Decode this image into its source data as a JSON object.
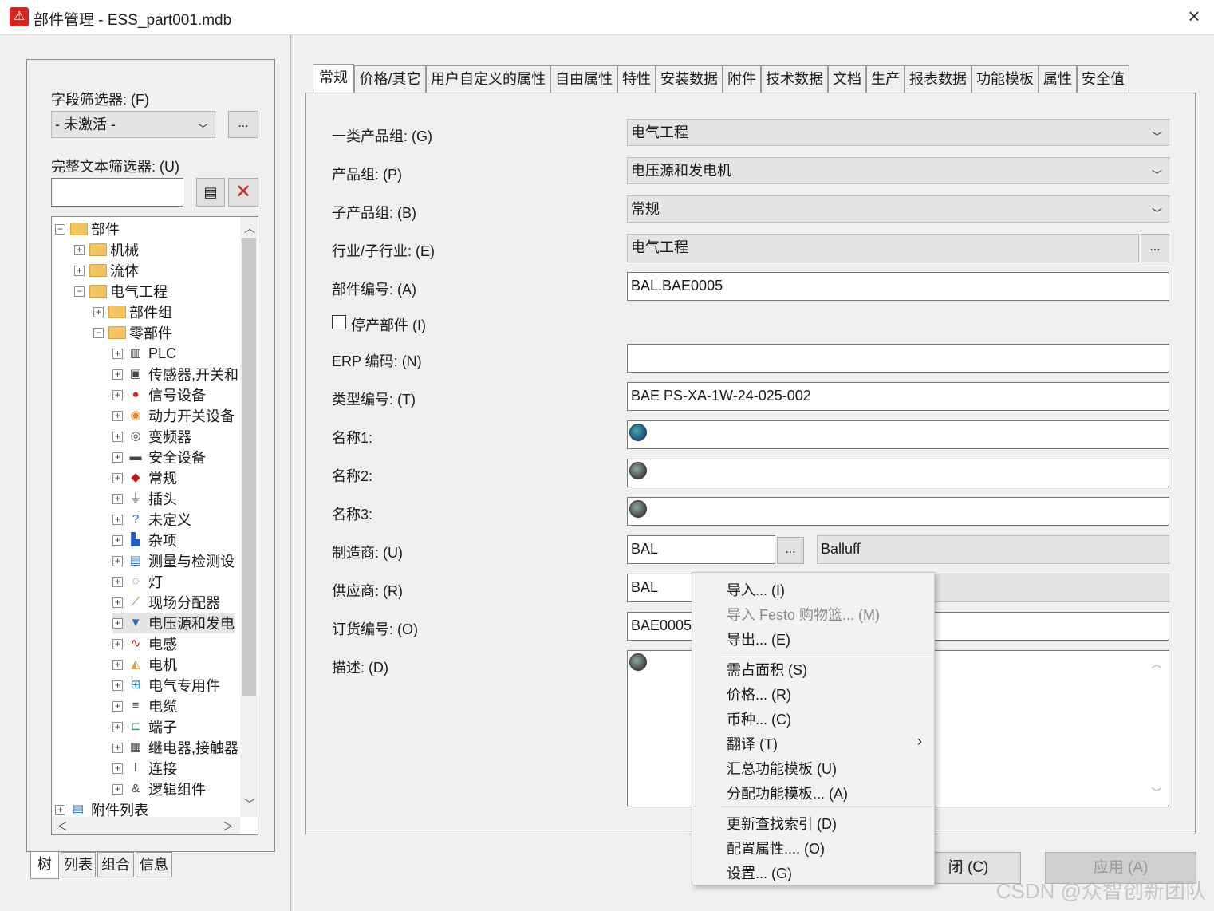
{
  "window": {
    "title": "部件管理 - ESS_part001.mdb",
    "icon": "warning-triangle-icon"
  },
  "left": {
    "field_filter_label": "字段筛选器: (F)",
    "field_filter_value": "- 未激活 -",
    "more_btn": "...",
    "text_filter_label": "完整文本筛选器: (U)",
    "text_filter_value": "",
    "tree": [
      {
        "label": "部件",
        "icon": "folder-icon",
        "exp": "−"
      },
      {
        "label": "机械",
        "icon": "folder-icon",
        "exp": "+"
      },
      {
        "label": "流体",
        "icon": "folder-icon",
        "exp": "+"
      },
      {
        "label": "电气工程",
        "icon": "folder-icon",
        "exp": "−"
      },
      {
        "label": "部件组",
        "icon": "folder-icon",
        "exp": "+"
      },
      {
        "label": "零部件",
        "icon": "folder-icon",
        "exp": "−"
      },
      {
        "label": "PLC",
        "icon": "plc-icon",
        "exp": "+"
      },
      {
        "label": "传感器,开关和",
        "icon": "sensor-icon",
        "exp": "+"
      },
      {
        "label": "信号设备",
        "icon": "signal-icon",
        "exp": "+"
      },
      {
        "label": "动力开关设备",
        "icon": "power-switch-icon",
        "exp": "+"
      },
      {
        "label": "变频器",
        "icon": "inverter-icon",
        "exp": "+"
      },
      {
        "label": "安全设备",
        "icon": "safety-icon",
        "exp": "+"
      },
      {
        "label": "常规",
        "icon": "general-icon",
        "exp": "+"
      },
      {
        "label": "插头",
        "icon": "plug-icon",
        "exp": "+"
      },
      {
        "label": "未定义",
        "icon": "question-icon",
        "exp": "+"
      },
      {
        "label": "杂项",
        "icon": "misc-icon",
        "exp": "+"
      },
      {
        "label": "测量与检测设",
        "icon": "meter-icon",
        "exp": "+"
      },
      {
        "label": "灯",
        "icon": "lamp-icon",
        "exp": "+"
      },
      {
        "label": "现场分配器",
        "icon": "distributor-icon",
        "exp": "+"
      },
      {
        "label": "电压源和发电",
        "icon": "generator-icon",
        "exp": "+"
      },
      {
        "label": "电感",
        "icon": "inductor-icon",
        "exp": "+"
      },
      {
        "label": "电机",
        "icon": "motor-icon",
        "exp": "+"
      },
      {
        "label": "电气专用件",
        "icon": "special-icon",
        "exp": "+"
      },
      {
        "label": "电缆",
        "icon": "cable-icon",
        "exp": "+"
      },
      {
        "label": "端子",
        "icon": "terminal-icon",
        "exp": "+"
      },
      {
        "label": "继电器,接触器",
        "icon": "relay-icon",
        "exp": "+"
      },
      {
        "label": "连接",
        "icon": "connection-icon",
        "exp": "+"
      },
      {
        "label": "逻辑组件",
        "icon": "logic-icon",
        "exp": "+"
      },
      {
        "label": "附件列表",
        "icon": "list-icon",
        "exp": "+"
      }
    ],
    "bottom_tabs": [
      "树",
      "列表",
      "组合",
      "信息"
    ]
  },
  "tabs": [
    "常规",
    "价格/其它",
    "用户自定义的属性",
    "自由属性",
    "特性",
    "安装数据",
    "附件",
    "技术数据",
    "文档",
    "生产",
    "报表数据",
    "功能模板",
    "属性",
    "安全值"
  ],
  "form": {
    "group1_label": "一类产品组: (G)",
    "group1_value": "电气工程",
    "group_label": "产品组: (P)",
    "group_value": "电压源和发电机",
    "subgroup_label": "子产品组: (B)",
    "subgroup_value": "常规",
    "industry_label": "行业/子行业: (E)",
    "industry_value": "电气工程",
    "partno_label": "部件编号: (A)",
    "partno_value": "BAL.BAE0005",
    "discontinued_label": "停产部件 (I)",
    "erp_label": "ERP 编码: (N)",
    "erp_value": "",
    "type_label": "类型编号: (T)",
    "type_value": "BAE PS-XA-1W-24-025-002",
    "name1_label": "名称1:",
    "name2_label": "名称2:",
    "name3_label": "名称3:",
    "maker_label": "制造商: (U)",
    "maker_code": "BAL",
    "maker_name": "Balluff",
    "supplier_label": "供应商: (R)",
    "supplier_code": "BAL",
    "order_label": "订货编号: (O)",
    "order_value": "BAE0005",
    "desc_label": "描述: (D)"
  },
  "buttons": {
    "close": "闭 (C)",
    "apply": "应用 (A)"
  },
  "context_menu": [
    {
      "label": "导入... (I)",
      "disabled": false
    },
    {
      "label": "导入 Festo 购物篮... (M)",
      "disabled": true
    },
    {
      "label": "导出... (E)",
      "disabled": false
    },
    {
      "label": "需占面积 (S)",
      "disabled": false
    },
    {
      "label": "价格... (R)",
      "disabled": false
    },
    {
      "label": "币种... (C)",
      "disabled": false
    },
    {
      "label": "翻译 (T)",
      "disabled": false
    },
    {
      "label": "汇总功能模板 (U)",
      "disabled": false
    },
    {
      "label": "分配功能模板... (A)",
      "disabled": false
    },
    {
      "label": "更新查找索引 (D)",
      "disabled": false
    },
    {
      "label": "配置属性.... (O)",
      "disabled": false
    },
    {
      "label": "设置... (G)",
      "disabled": false
    }
  ],
  "watermark": "CSDN @众智创新团队"
}
